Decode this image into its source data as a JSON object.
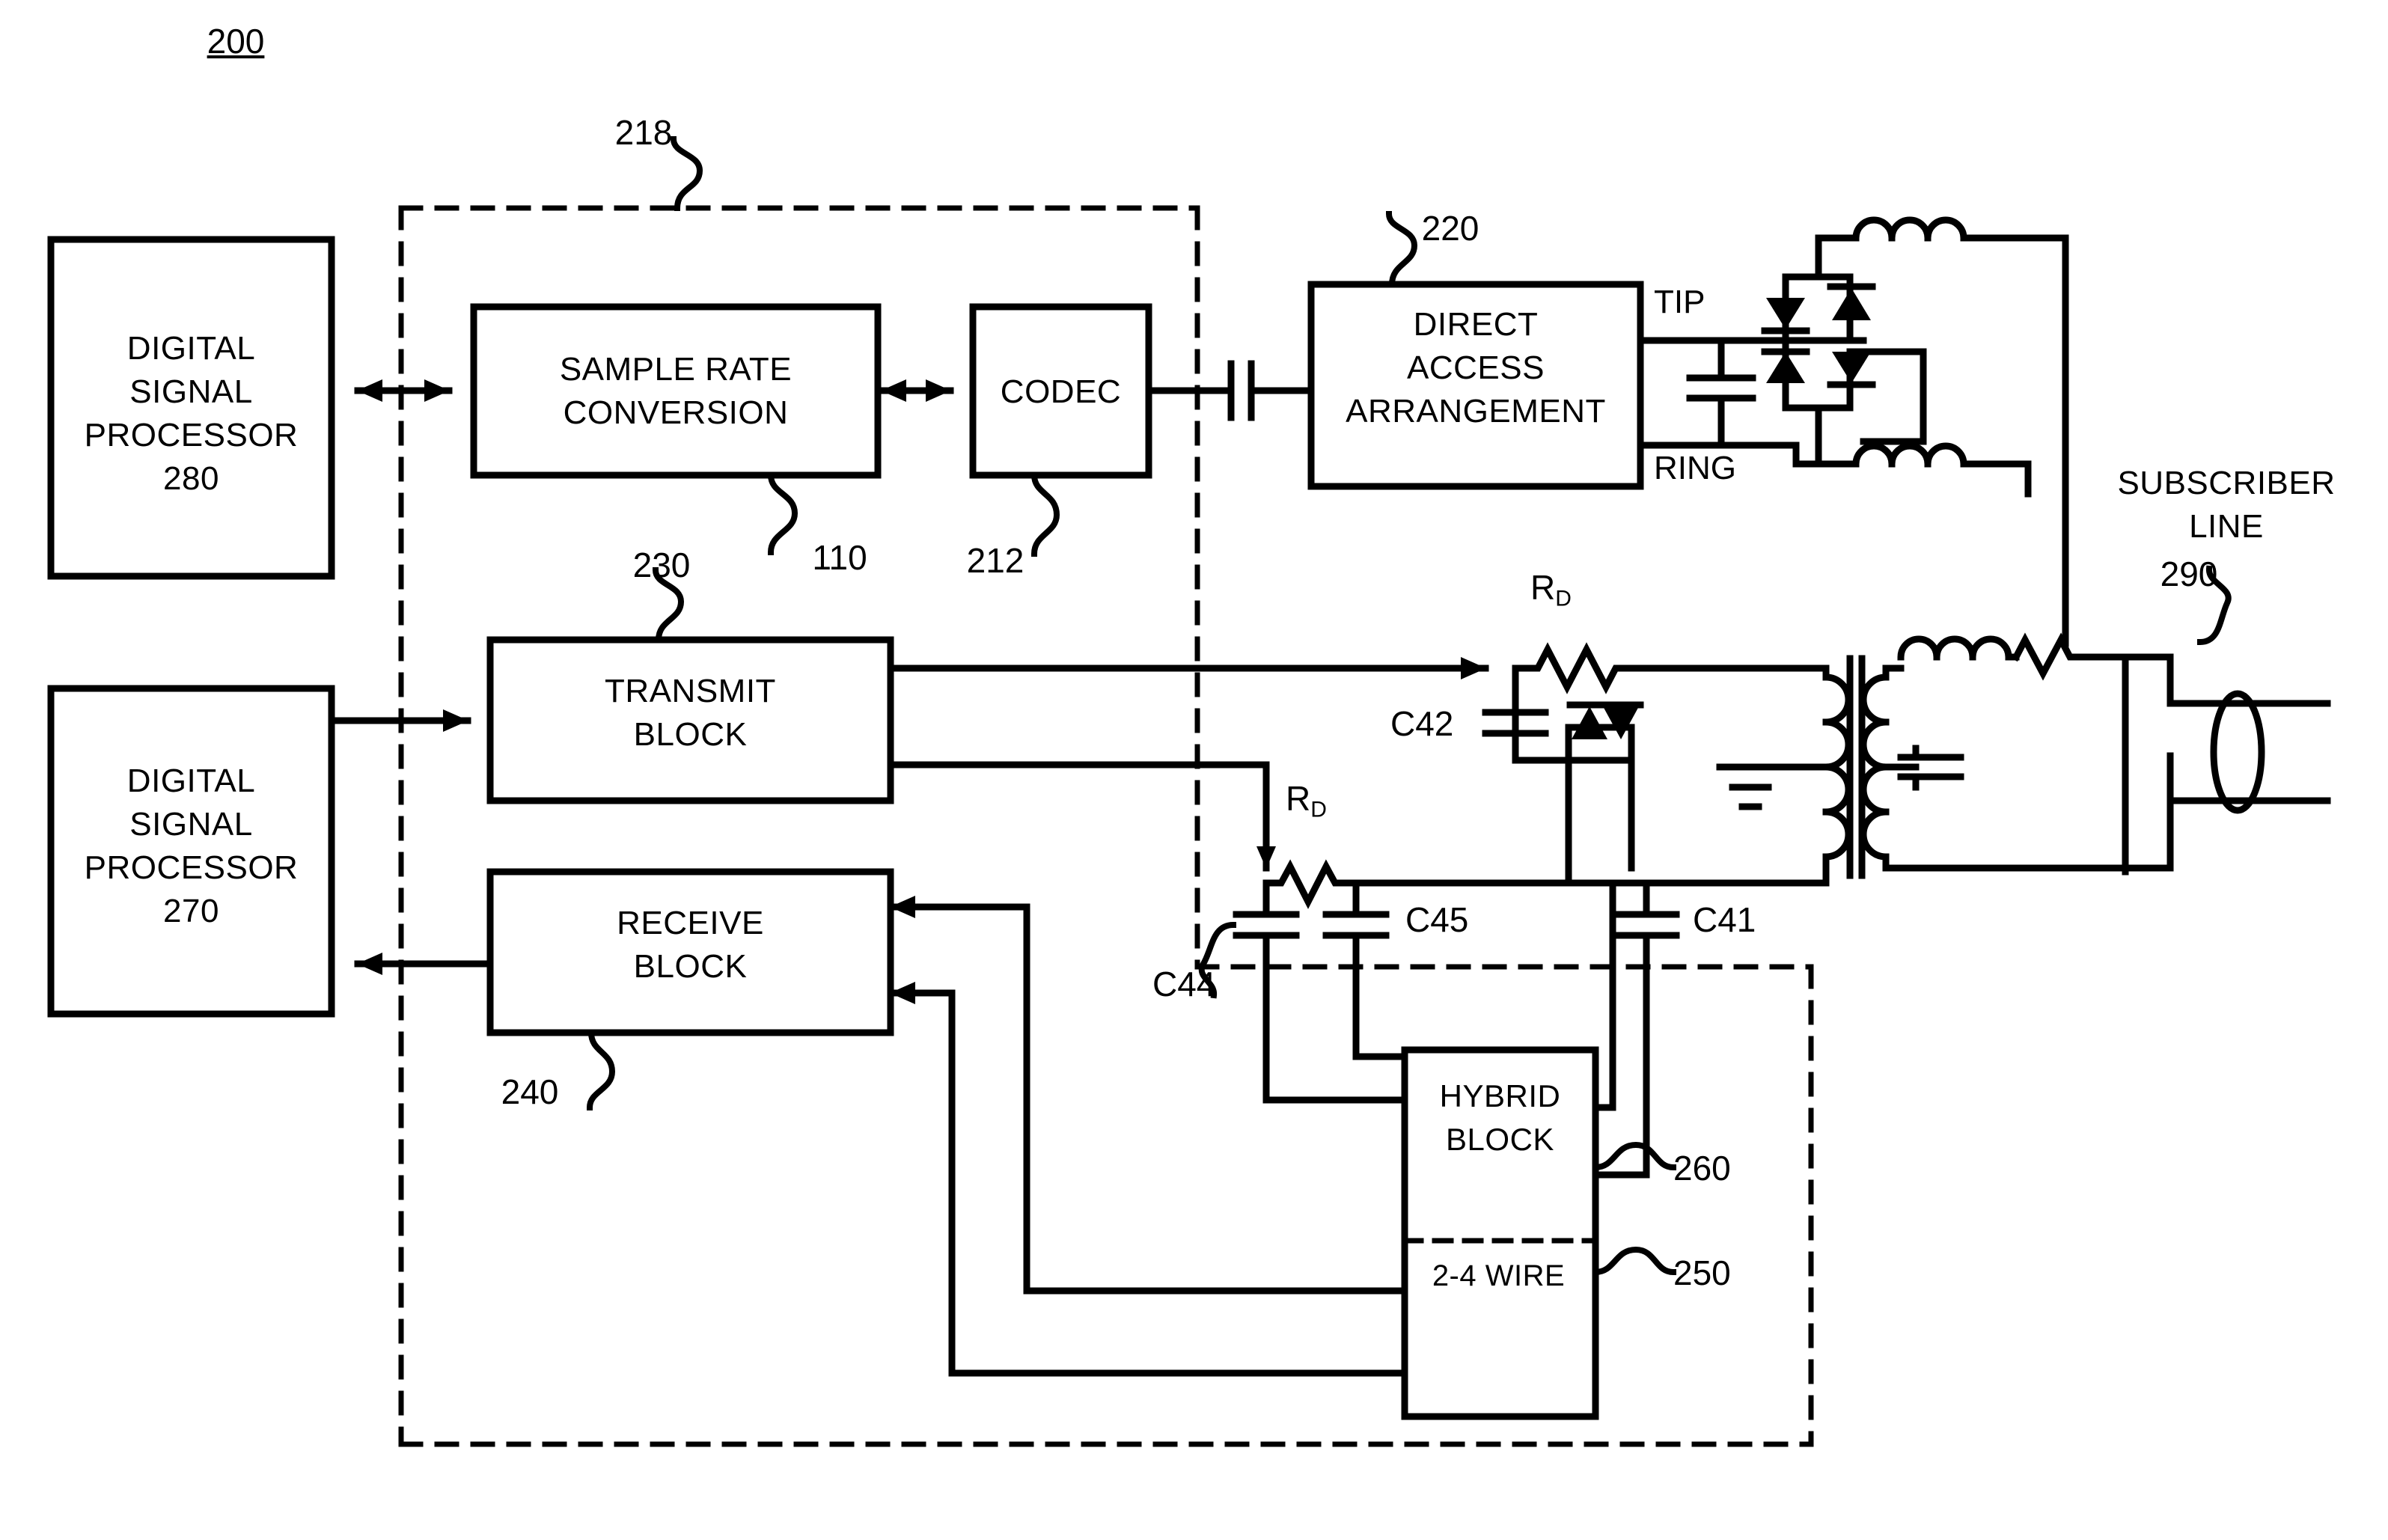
{
  "figure": {
    "number": "200",
    "type": "patent-block-diagram"
  },
  "blocks": {
    "dsp280": {
      "line1": "DIGITAL",
      "line2": "SIGNAL",
      "line3": "PROCESSOR",
      "ref": "280"
    },
    "dsp270": {
      "line1": "DIGITAL",
      "line2": "SIGNAL",
      "line3": "PROCESSOR",
      "ref": "270"
    },
    "sample_rate": {
      "line1": "SAMPLE RATE",
      "line2": "CONVERSION",
      "ref": "110"
    },
    "codec": {
      "line1": "CODEC",
      "ref": "212"
    },
    "daa": {
      "line1": "DIRECT",
      "line2": "ACCESS",
      "line3": "ARRANGEMENT",
      "ref": "220"
    },
    "transmit": {
      "line1": "TRANSMIT",
      "line2": "BLOCK",
      "ref": "230"
    },
    "receive": {
      "line1": "RECEIVE",
      "line2": "BLOCK",
      "ref": "240"
    },
    "hybrid": {
      "line1": "HYBRID",
      "line2": "BLOCK",
      "ref": "260"
    },
    "two_four_wire": {
      "line1": "2-4 WIRE",
      "ref": "250"
    }
  },
  "boundaries": {
    "outer_dashed_ref": "218",
    "inner_dashed_ref": ""
  },
  "pins": {
    "tip": "TIP",
    "ring": "RING"
  },
  "line": {
    "line1": "SUBSCRIBER",
    "line2": "LINE",
    "ref": "290"
  },
  "components": {
    "capacitors": [
      "C42",
      "C44",
      "C45",
      "C41"
    ],
    "resistors": [
      {
        "name": "R",
        "sub": "D"
      },
      {
        "name": "R",
        "sub": "D"
      }
    ],
    "resistor_label_main": "R",
    "resistor_label_sub": "D"
  },
  "colors": {
    "ink": "#000000",
    "paper": "#ffffff"
  }
}
